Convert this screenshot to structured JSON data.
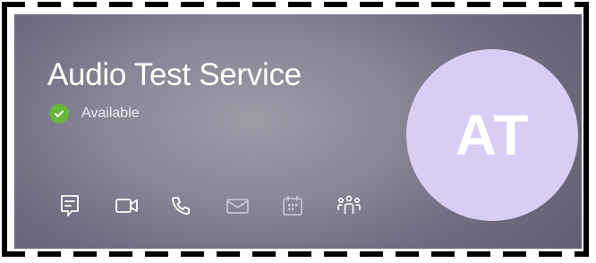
{
  "contact": {
    "name": "Audio Test Service",
    "status": "Available",
    "initials": "AT"
  },
  "colors": {
    "status_available": "#69b73a",
    "avatar_bg": "#d8cdf3"
  },
  "actions": [
    {
      "name": "chat",
      "icon": "chat-icon",
      "enabled": true
    },
    {
      "name": "video-call",
      "icon": "video-camera-icon",
      "enabled": true
    },
    {
      "name": "audio-call",
      "icon": "phone-icon",
      "enabled": true
    },
    {
      "name": "email",
      "icon": "mail-icon",
      "enabled": false
    },
    {
      "name": "meeting",
      "icon": "calendar-icon",
      "enabled": false
    },
    {
      "name": "teams",
      "icon": "people-group-icon",
      "enabled": true
    }
  ]
}
